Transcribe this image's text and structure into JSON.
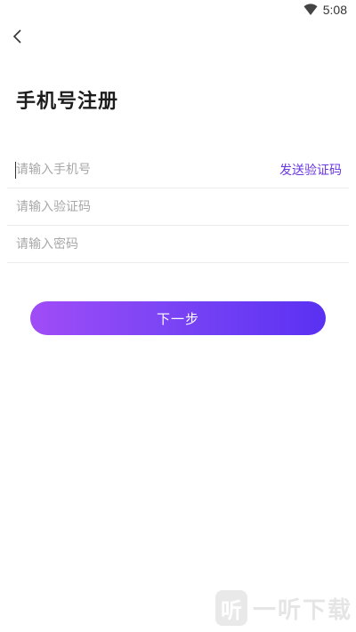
{
  "status_bar": {
    "time": "5:08",
    "icons": [
      "wifi-icon"
    ]
  },
  "header": {
    "back_icon": "chevron-left-icon",
    "title": "手机号注册"
  },
  "form": {
    "phone": {
      "placeholder": "请输入手机号",
      "value": ""
    },
    "send_code_label": "发送验证码",
    "code": {
      "placeholder": "请输入验证码",
      "value": ""
    },
    "password": {
      "placeholder": "请输入密码",
      "value": ""
    }
  },
  "next_button": {
    "label": "下一步"
  },
  "watermark": {
    "logo_glyph": "听",
    "text": "一听下载"
  },
  "colors": {
    "accent": "#6a37e0",
    "gradient_start": "#a04cf6",
    "gradient_end": "#5a31f2"
  }
}
